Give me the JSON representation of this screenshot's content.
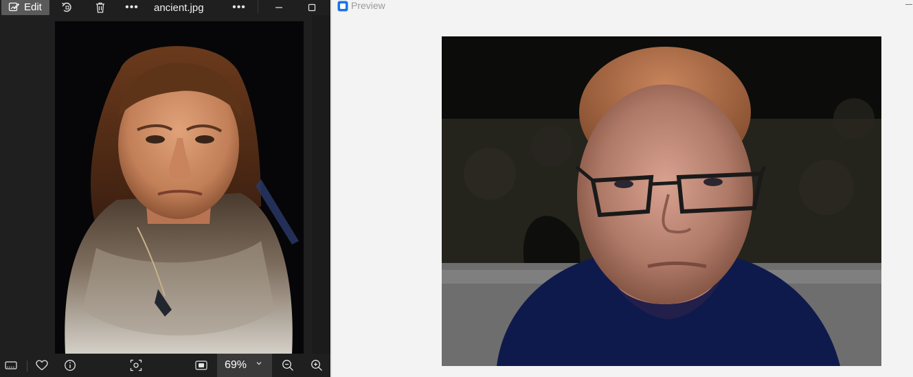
{
  "viewer": {
    "toolbar": {
      "edit_label": "Edit",
      "filename": "ancient.jpg",
      "more_label": "•••"
    },
    "zoom": {
      "value": "69%"
    },
    "colors": {
      "background": "#1f1f1f",
      "button_active": "#5a5a5a",
      "zoom_box": "#3a3a3a"
    }
  },
  "preview": {
    "title": "Preview",
    "accent": "#1a73e8"
  }
}
